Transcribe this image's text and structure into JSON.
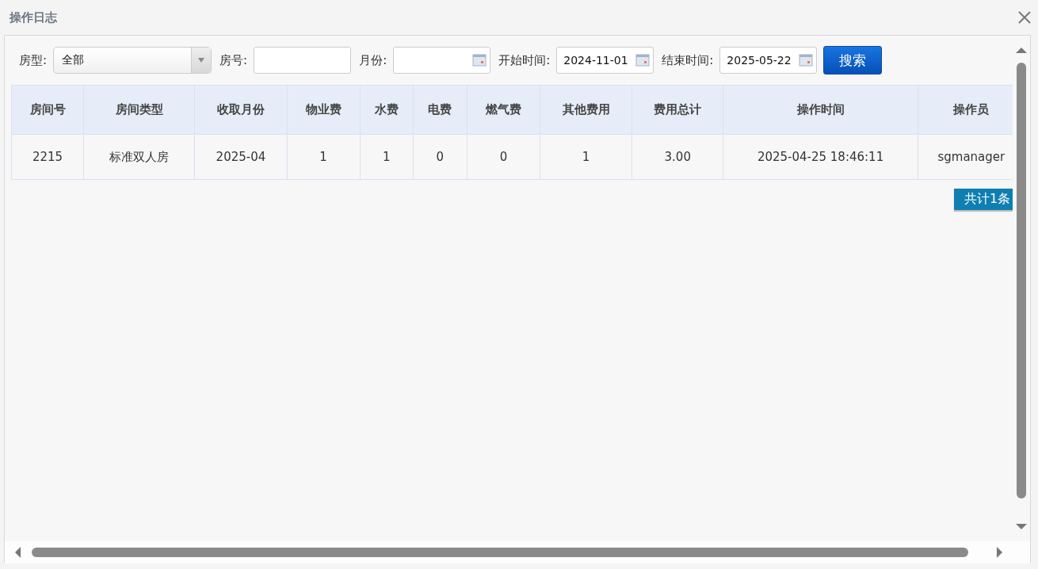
{
  "window": {
    "title": "操作日志"
  },
  "filters": [
    {
      "kind": "select",
      "label": "房型:",
      "value": "全部"
    },
    {
      "kind": "text",
      "label": "房号:"
    },
    {
      "kind": "date",
      "label": "月份:"
    },
    {
      "kind": "date",
      "label": "开始时间:",
      "value": "2024-11-01"
    },
    {
      "kind": "date",
      "label": "结束时间:",
      "value": "2025-05-22"
    }
  ],
  "search_button": "搜索",
  "table": {
    "columns": [
      "房间号",
      "房间类型",
      "收取月份",
      "物业费",
      "水费",
      "电费",
      "燃气费",
      "其他费用",
      "费用总计",
      "操作时间",
      "操作员"
    ],
    "rows": [
      [
        "2215",
        "标准双人房",
        "2025-04",
        "1",
        "1",
        "0",
        "0",
        "1",
        "3.00",
        "2025-04-25 18:46:11",
        "sgmanager"
      ]
    ]
  },
  "total": "共计1条"
}
